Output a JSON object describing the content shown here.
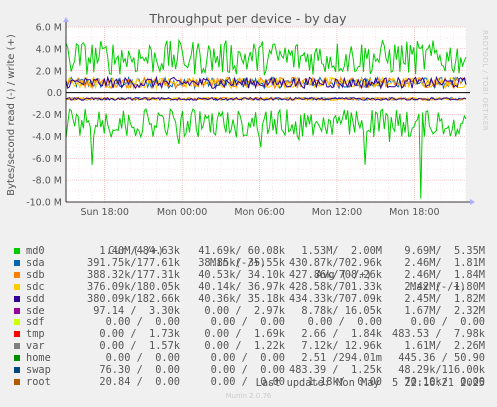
{
  "title": "Throughput per device - by day",
  "ylabel": "Bytes/second read (-) / write (+)",
  "side_label": "RRDTOOL / TOBI OETIKER",
  "footer": {
    "last_update": "Last update: Mon May  5 22:16:21 2025",
    "munin_version": "Munin 2.0.76"
  },
  "legend_headers": {
    "cur": "Cur (-/+)",
    "min": "Min (-/+)",
    "avg": "Avg (-/+)",
    "max": "Max (-/+)"
  },
  "legend": [
    {
      "name": "md0",
      "color": "#00cc00",
      "cur": "1.40M/484.63k",
      "min": "41.69k/ 60.08k",
      "avg": "1.53M/  2.00M",
      "max": "9.69M/  5.35M"
    },
    {
      "name": "sda",
      "color": "#0066b3",
      "cur": "391.75k/177.61k",
      "min": "38.85k/ 35.55k",
      "avg": "430.87k/702.96k",
      "max": "2.46M/  1.81M"
    },
    {
      "name": "sdb",
      "color": "#ff8000",
      "cur": "388.32k/177.31k",
      "min": "40.53k/ 34.10k",
      "avg": "427.86k/708.26k",
      "max": "2.46M/  1.84M"
    },
    {
      "name": "sdc",
      "color": "#ffcc00",
      "cur": "376.09k/180.05k",
      "min": "40.14k/ 36.97k",
      "avg": "428.58k/701.33k",
      "max": "2.42M/  1.80M"
    },
    {
      "name": "sdd",
      "color": "#330099",
      "cur": "380.09k/182.66k",
      "min": "40.36k/ 35.18k",
      "avg": "434.33k/707.09k",
      "max": "2.45M/  1.82M"
    },
    {
      "name": "sde",
      "color": "#990099",
      "cur": "97.14 /  3.30k",
      "min": "0.00 /  2.97k",
      "avg": "8.78k/ 16.05k",
      "max": "1.67M/  2.32M"
    },
    {
      "name": "sdf",
      "color": "#ccff00",
      "cur": "0.00 /  0.00",
      "min": "0.00 /  0.00",
      "avg": "0.00 /  0.00",
      "max": "0.00 /  0.00"
    },
    {
      "name": "tmp",
      "color": "#ff0000",
      "cur": "0.00 /  1.73k",
      "min": "0.00 /  1.69k",
      "avg": "2.66 /  1.84k",
      "max": "483.53 /  7.98k"
    },
    {
      "name": "var",
      "color": "#808080",
      "cur": "0.00 /  1.57k",
      "min": "0.00 /  1.22k",
      "avg": "7.12k/ 12.96k",
      "max": "1.61M/  2.26M"
    },
    {
      "name": "home",
      "color": "#008f00",
      "cur": "0.00 /  0.00",
      "min": "0.00 /  0.00",
      "avg": "2.51 /294.01m",
      "max": "445.36 / 50.90"
    },
    {
      "name": "swap",
      "color": "#00487d",
      "cur": "76.30 /  0.00",
      "min": "0.00 /  0.00",
      "avg": "483.39 /  1.25k",
      "max": "48.29k/116.00k"
    },
    {
      "name": "root",
      "color": "#b35a00",
      "cur": "20.84 /  0.00",
      "min": "0.00 /  0.00",
      "avg": "1.18k/  0.00",
      "max": "70.10k/  0.00"
    }
  ],
  "chart_data": {
    "type": "line",
    "title": "Throughput per device - by day",
    "ylabel": "Bytes/second read (-) / write (+)",
    "xlabel": "",
    "ylim": [
      -10000000,
      6000000
    ],
    "yticks": [
      -10000000,
      -8000000,
      -6000000,
      -4000000,
      -2000000,
      0,
      2000000,
      4000000,
      6000000
    ],
    "ytick_labels": [
      "-10.0 M",
      "-8.0 M",
      "-6.0 M",
      "-4.0 M",
      "-2.0 M",
      "0.0",
      "2.0 M",
      "4.0 M",
      "6.0 M"
    ],
    "xtick_labels": [
      "Sun 18:00",
      "Mon 00:00",
      "Mon 06:00",
      "Mon 12:00",
      "Mon 18:00"
    ],
    "xlim_hours": [
      -31,
      0
    ],
    "xtick_hours": [
      -28,
      -22,
      -16,
      -10,
      -4
    ],
    "grid": true,
    "series": [
      {
        "name": "md0",
        "color": "#00cc00",
        "write_level": 3200000,
        "write_jitter": 1600000,
        "read_level": -1500000,
        "read_jitter": 2600000,
        "write_max": 5350000,
        "read_max": 9690000
      },
      {
        "name": "sda",
        "color": "#0066b3",
        "write_level": 900000,
        "write_jitter": 500000,
        "read_level": -450000,
        "read_jitter": 250000
      },
      {
        "name": "sdb",
        "color": "#ff8000",
        "write_level": 900000,
        "write_jitter": 500000,
        "read_level": -450000,
        "read_jitter": 250000
      },
      {
        "name": "sdc",
        "color": "#ffcc00",
        "write_level": 900000,
        "write_jitter": 500000,
        "read_level": -450000,
        "read_jitter": 250000
      },
      {
        "name": "sdd",
        "color": "#330099",
        "write_level": 900000,
        "write_jitter": 500000,
        "read_level": -450000,
        "read_jitter": 250000
      }
    ],
    "spikes": [
      {
        "series": "md0",
        "hour": -22.2,
        "value": -4700000
      },
      {
        "series": "md0",
        "hour": -15.9,
        "value": -5000000
      },
      {
        "series": "md0",
        "hour": -13.0,
        "value": -4300000
      },
      {
        "series": "md0",
        "hour": -7.8,
        "value": -6600000
      },
      {
        "series": "md0",
        "hour": -5.9,
        "value": -4500000
      },
      {
        "series": "md0",
        "hour": -3.5,
        "value": -9690000
      },
      {
        "series": "md0",
        "hour": -29.0,
        "value": -6600000
      }
    ]
  }
}
